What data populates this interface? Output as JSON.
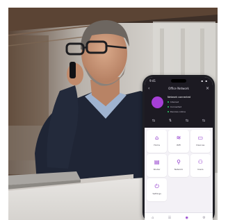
{
  "phone": {
    "status_time": "9:41",
    "status_icons": "▪ ▪",
    "nav": {
      "back": "‹",
      "title": "Office Network",
      "close": "×"
    },
    "device_color": "#a63fd6",
    "status_lines": [
      "Network connected",
      "Internet",
      "Connected",
      "Devices online"
    ],
    "quick_actions": [
      "⇆",
      "⇅",
      "⇆",
      "⇆"
    ],
    "tiles": [
      {
        "icon": "⌂",
        "label": "Home"
      },
      {
        "icon": "≋",
        "label": "WiFi"
      },
      {
        "icon": "▭",
        "label": "Devices"
      },
      {
        "icon": "▤",
        "label": "Router"
      },
      {
        "icon": "⚲",
        "label": "Network"
      },
      {
        "icon": "⚇",
        "label": "Users"
      },
      {
        "icon": "⏻",
        "label": "Settings"
      }
    ],
    "tabs": [
      "⌂",
      "☰",
      "◉",
      "⚙"
    ],
    "accent": "#8b2fc9"
  }
}
